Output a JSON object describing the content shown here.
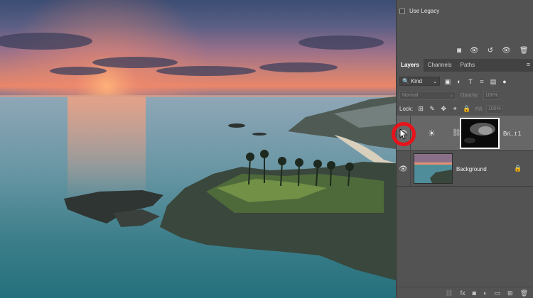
{
  "properties": {
    "use_legacy_label": "Use Legacy"
  },
  "adjust_icons": [
    "◙",
    "👁",
    "↺",
    "👁",
    "🗑"
  ],
  "tabs": [
    {
      "label": "Layers",
      "active": true
    },
    {
      "label": "Channels",
      "active": false
    },
    {
      "label": "Paths",
      "active": false
    }
  ],
  "panel_menu_icon": "≡",
  "filter": {
    "kind_label": "Kind",
    "search_glyph": "🔍",
    "chevron": "⌄"
  },
  "filter_icons": [
    "▣",
    "◐",
    "T",
    "⌗",
    "▤"
  ],
  "blend": {
    "mode": "Normal",
    "opacity_label": "Opacity:",
    "opacity_value": "100%",
    "fill_label": "Fill:",
    "fill_value": "100%",
    "chevron": "⌄"
  },
  "lock": {
    "label": "Lock:",
    "icons": [
      "⊞",
      "✎",
      "✥",
      "⌖",
      "🔒"
    ]
  },
  "layers": [
    {
      "name": "Bri...t 1",
      "visible": true,
      "type": "adjustment",
      "adjust_glyph": "☀",
      "chain_glyph": "⛓"
    },
    {
      "name": "Background",
      "visible": true,
      "type": "pixel",
      "locked": true,
      "lock_glyph": "🔒"
    }
  ],
  "eye_glyph": "👁",
  "bottom_icons": [
    "⛓",
    "fx",
    "◙",
    "◐",
    "▭",
    "⊞",
    "🗑"
  ],
  "colors": {
    "accent_red": "#e8131a",
    "panel_bg": "#535353",
    "selected_layer_bg": "#676767"
  }
}
